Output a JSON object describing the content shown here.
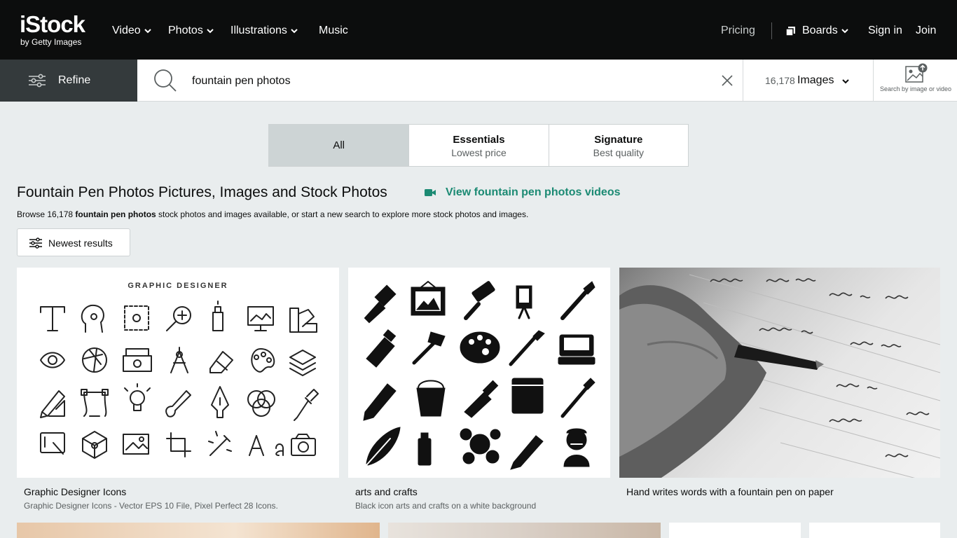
{
  "brand": {
    "logo_main": "iStock",
    "logo_sub": "by Getty Images"
  },
  "nav": [
    {
      "label": "Video"
    },
    {
      "label": "Photos"
    },
    {
      "label": "Illustrations"
    },
    {
      "label": "Music"
    }
  ],
  "account": {
    "pricing": "Pricing",
    "boards": "Boards",
    "signin": "Sign in",
    "join": "Join"
  },
  "search": {
    "refine_label": "Refine",
    "query": "fountain pen photos",
    "result_count": "16,178",
    "media_type": "Images",
    "search_by_image": "Search by image or video"
  },
  "tabs": [
    {
      "title": "All",
      "subtitle": ""
    },
    {
      "title": "Essentials",
      "subtitle": "Lowest price"
    },
    {
      "title": "Signature",
      "subtitle": "Best quality"
    }
  ],
  "page": {
    "title": "Fountain Pen Photos Pictures, Images and Stock Photos",
    "video_link": "View fountain pen photos videos",
    "browse_prefix": "Browse 16,178 ",
    "browse_term": "fountain pen photos",
    "browse_suffix": " stock photos and images available, or start a new search to explore more stock photos and images.",
    "sort_label": "Newest results"
  },
  "results": [
    {
      "title": "Graphic Designer Icons",
      "subtitle": "Graphic Designer Icons - Vector EPS 10 File, Pixel Perfect 28 Icons.",
      "image_heading": "GRAPHIC DESIGNER"
    },
    {
      "title": "arts and crafts",
      "subtitle": "Black icon arts and crafts on a white background"
    },
    {
      "title": "Hand writes words with a fountain pen on paper",
      "subtitle": ""
    }
  ],
  "colors": {
    "header_bg": "#0c0d0d",
    "accent_green": "#1b8a73",
    "page_bg": "#e9edee",
    "refine_bg": "#343a3c"
  },
  "icons": [
    "sliders-icon",
    "search-icon",
    "clear-icon",
    "chevron-down-icon",
    "boards-icon",
    "search-by-image-icon",
    "video-camera-icon"
  ]
}
